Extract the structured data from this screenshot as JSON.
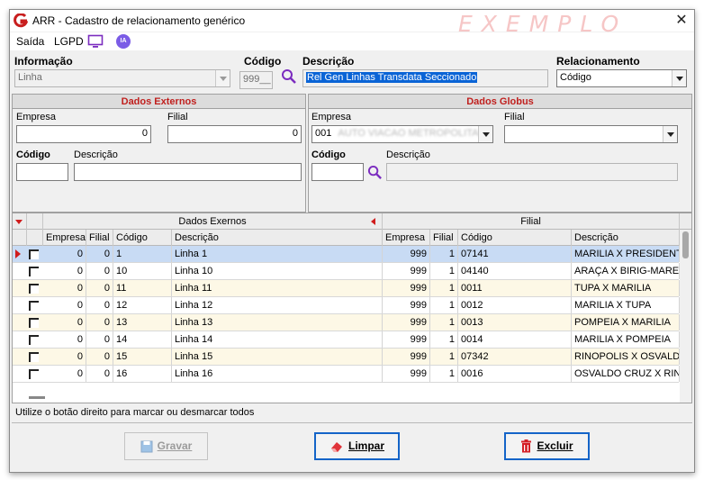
{
  "window": {
    "title": "ARR - Cadastro de relacionamento genérico",
    "watermark": "EXEMPLO",
    "close_glyph": "✕",
    "icon": "app-logo-icon"
  },
  "menu": {
    "items": [
      "Saída",
      "LGPD"
    ],
    "icons": [
      "monitor-icon",
      "ia-icon"
    ],
    "ia_text": "IA"
  },
  "filters": {
    "informacao": {
      "label": "Informação",
      "value": "Linha"
    },
    "codigo": {
      "label": "Código",
      "value": "999__"
    },
    "descricao": {
      "label": "Descrição",
      "value": "Rel Gen Linhas Transdata Seccionado"
    },
    "relacionamento": {
      "label": "Relacionamento",
      "value": "Código"
    }
  },
  "dados_externos": {
    "title": "Dados Externos",
    "empresa": {
      "label": "Empresa",
      "value": "0"
    },
    "filial": {
      "label": "Filial",
      "value": "0"
    },
    "codigo": {
      "label": "Código",
      "value": ""
    },
    "descricao": {
      "label": "Descrição",
      "value": ""
    }
  },
  "dados_globus": {
    "title": "Dados Globus",
    "empresa": {
      "label": "Empresa",
      "value": "001",
      "blurred": "AUTO VIACAO METROPOLITAN"
    },
    "filial": {
      "label": "Filial",
      "value": ""
    },
    "codigo": {
      "label": "Código",
      "value": ""
    },
    "descricao": {
      "label": "Descrição",
      "value": ""
    }
  },
  "grid": {
    "group_headers": [
      "Dados Exernos",
      "Filial"
    ],
    "columns": [
      "Empresa",
      "Filial",
      "Código",
      "Descrição",
      "Empresa",
      "Filial",
      "Código",
      "Descrição"
    ],
    "rows": [
      [
        "0",
        "0",
        "1",
        "Linha 1",
        "999",
        "1",
        "07141",
        "MARILIA X PRESIDENTE"
      ],
      [
        "0",
        "0",
        "10",
        "Linha 10",
        "999",
        "1",
        "04140",
        "ARAÇA X BIRIG-MAREC"
      ],
      [
        "0",
        "0",
        "11",
        "Linha 11",
        "999",
        "1",
        "0011",
        "TUPA X MARILIA"
      ],
      [
        "0",
        "0",
        "12",
        "Linha 12",
        "999",
        "1",
        "0012",
        "MARILIA X TUPA"
      ],
      [
        "0",
        "0",
        "13",
        "Linha 13",
        "999",
        "1",
        "0013",
        "POMPEIA X MARILIA"
      ],
      [
        "0",
        "0",
        "14",
        "Linha 14",
        "999",
        "1",
        "0014",
        "MARILIA X POMPEIA"
      ],
      [
        "0",
        "0",
        "15",
        "Linha 15",
        "999",
        "1",
        "07342",
        "RINOPOLIS X OSVALDO"
      ],
      [
        "0",
        "0",
        "16",
        "Linha 16",
        "999",
        "1",
        "0016",
        "OSVALDO CRUZ X RIN"
      ]
    ]
  },
  "status": "Utilize o botão direito para marcar ou desmarcar todos",
  "buttons": {
    "gravar": "Gravar",
    "limpar": "Limpar",
    "excluir": "Excluir"
  },
  "colors": {
    "accent_red": "#c0201e",
    "selection_blue": "#0a64d6",
    "watermark": "#f6c6c6"
  }
}
